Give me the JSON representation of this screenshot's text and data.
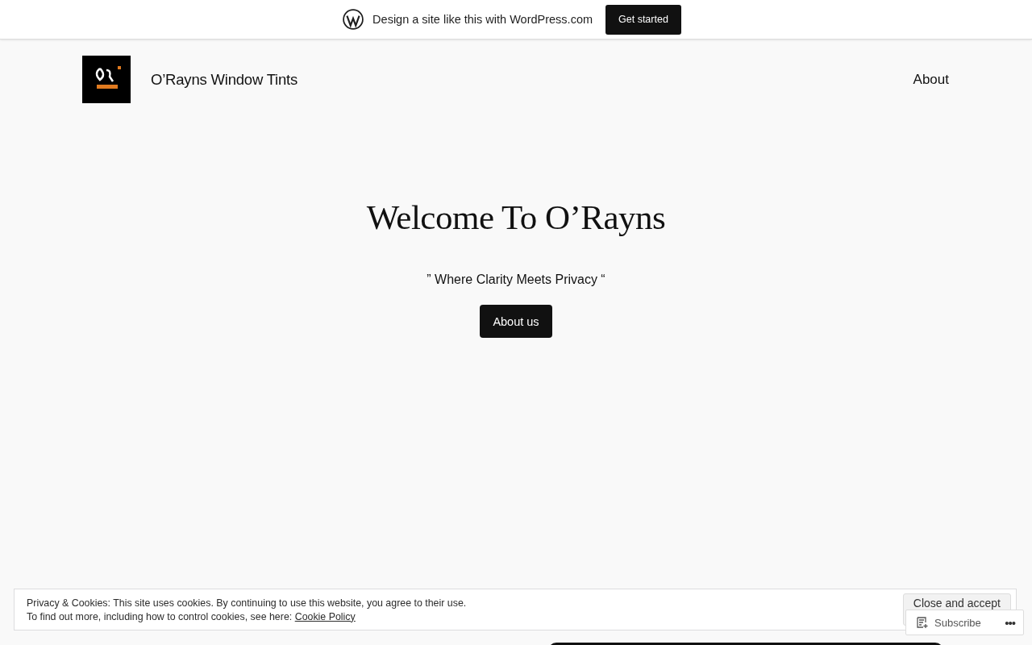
{
  "wp_bar": {
    "message": "Design a site like this with WordPress.com",
    "button": "Get started"
  },
  "header": {
    "site_title": "O’Rayns Window Tints",
    "nav": [
      {
        "label": "About"
      }
    ]
  },
  "hero": {
    "heading": "Welcome To O’Rayns",
    "tagline": "” Where Clarity Meets Privacy “",
    "button": "About us"
  },
  "cookie_banner": {
    "line_1": "Privacy & Cookies: This site uses cookies. By continuing to use this website, you agree to their use.",
    "line_2": "To find out more, including how to control cookies, see here:",
    "link": "Cookie Policy",
    "button": "Close and accept"
  },
  "subscribe_bar": {
    "button": "Subscribe",
    "more": "•••"
  }
}
